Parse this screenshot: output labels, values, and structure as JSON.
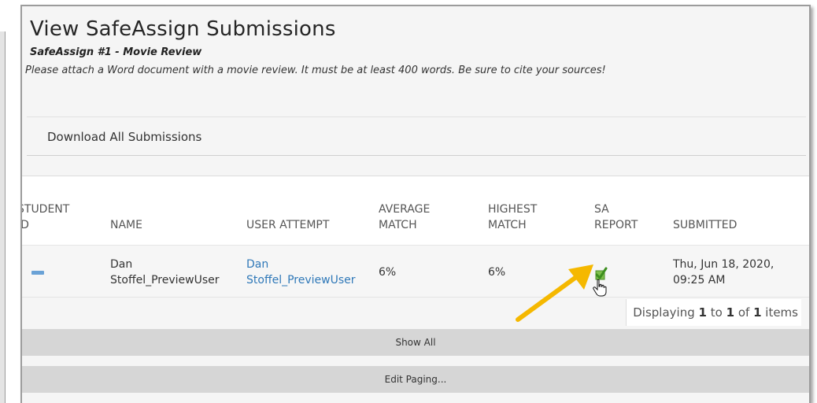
{
  "header": {
    "title": "View SafeAssign Submissions",
    "subtitle": "SafeAssign #1 - Movie Review",
    "instructions": "Please attach a Word document with a movie review. It must be at least 400 words. Be sure to cite your sources!"
  },
  "actions": {
    "download_all": "Download All Submissions"
  },
  "table": {
    "columns": [
      {
        "line1": "STUDENT",
        "line2": "ID"
      },
      {
        "line1": "NAME",
        "line2": ""
      },
      {
        "line1": "USER ATTEMPT",
        "line2": ""
      },
      {
        "line1": "AVERAGE",
        "line2": "MATCH"
      },
      {
        "line1": "HIGHEST",
        "line2": "MATCH"
      },
      {
        "line1": "SA",
        "line2": "REPORT"
      },
      {
        "line1": "SUBMITTED",
        "line2": ""
      }
    ],
    "rows": [
      {
        "name_line1": "Dan",
        "name_line2": "Stoffel_PreviewUser",
        "attempt_line1": "Dan",
        "attempt_line2": "Stoffel_PreviewUser",
        "average_match": "6%",
        "highest_match": "6%",
        "submitted_line1": "Thu, Jun 18, 2020,",
        "submitted_line2": "09:25 AM"
      }
    ]
  },
  "paging": {
    "prefix": "Displaying",
    "from": "1",
    "to_word": "to",
    "to": "1",
    "of_word": "of",
    "total": "1",
    "suffix": "items",
    "show_all": "Show All",
    "edit_paging": "Edit Paging..."
  },
  "colors": {
    "link": "#2f78b8",
    "arrow": "#f5b800",
    "check": "#5aa832",
    "button_bg": "#d6d6d6"
  },
  "icons": [
    "minus-icon",
    "checkmark-icon",
    "hand-cursor-icon",
    "arrow-icon"
  ]
}
